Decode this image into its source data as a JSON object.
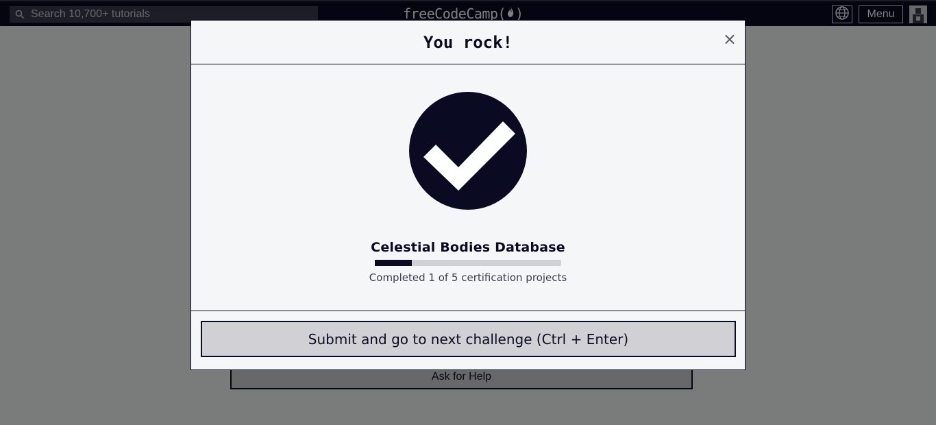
{
  "nav": {
    "search_placeholder": "Search 10,700+ tutorials",
    "logo_text": "freeCodeCamp(",
    "logo_close": ")",
    "menu_label": "Menu"
  },
  "page": {
    "ask_help_label": "Ask for Help"
  },
  "modal": {
    "title": "You rock!",
    "close_symbol": "×",
    "project_name": "Celestial Bodies Database",
    "progress_fraction": 0.2,
    "progress_text": "Completed 1 of 5 certification projects",
    "submit_label": "Submit and go to next challenge (Ctrl + Enter)"
  },
  "colors": {
    "nav_bg": "#0a0a23",
    "accent": "#0a0a23",
    "button_bg": "#d0d0d5",
    "modal_bg": "#f5f6f7"
  },
  "icons": [
    "search-icon",
    "flame-icon",
    "globe-icon",
    "avatar-icon",
    "close-icon",
    "checkmark-icon"
  ]
}
